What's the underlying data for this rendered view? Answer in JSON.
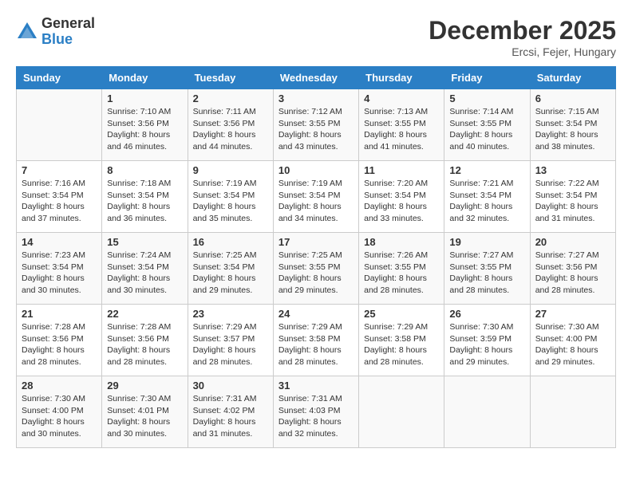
{
  "logo": {
    "general": "General",
    "blue": "Blue"
  },
  "title": {
    "month": "December 2025",
    "location": "Ercsi, Fejer, Hungary"
  },
  "weekdays": [
    "Sunday",
    "Monday",
    "Tuesday",
    "Wednesday",
    "Thursday",
    "Friday",
    "Saturday"
  ],
  "weeks": [
    [
      {
        "day": "",
        "info": ""
      },
      {
        "day": "1",
        "info": "Sunrise: 7:10 AM\nSunset: 3:56 PM\nDaylight: 8 hours\nand 46 minutes."
      },
      {
        "day": "2",
        "info": "Sunrise: 7:11 AM\nSunset: 3:56 PM\nDaylight: 8 hours\nand 44 minutes."
      },
      {
        "day": "3",
        "info": "Sunrise: 7:12 AM\nSunset: 3:55 PM\nDaylight: 8 hours\nand 43 minutes."
      },
      {
        "day": "4",
        "info": "Sunrise: 7:13 AM\nSunset: 3:55 PM\nDaylight: 8 hours\nand 41 minutes."
      },
      {
        "day": "5",
        "info": "Sunrise: 7:14 AM\nSunset: 3:55 PM\nDaylight: 8 hours\nand 40 minutes."
      },
      {
        "day": "6",
        "info": "Sunrise: 7:15 AM\nSunset: 3:54 PM\nDaylight: 8 hours\nand 38 minutes."
      }
    ],
    [
      {
        "day": "7",
        "info": "Sunrise: 7:16 AM\nSunset: 3:54 PM\nDaylight: 8 hours\nand 37 minutes."
      },
      {
        "day": "8",
        "info": "Sunrise: 7:18 AM\nSunset: 3:54 PM\nDaylight: 8 hours\nand 36 minutes."
      },
      {
        "day": "9",
        "info": "Sunrise: 7:19 AM\nSunset: 3:54 PM\nDaylight: 8 hours\nand 35 minutes."
      },
      {
        "day": "10",
        "info": "Sunrise: 7:19 AM\nSunset: 3:54 PM\nDaylight: 8 hours\nand 34 minutes."
      },
      {
        "day": "11",
        "info": "Sunrise: 7:20 AM\nSunset: 3:54 PM\nDaylight: 8 hours\nand 33 minutes."
      },
      {
        "day": "12",
        "info": "Sunrise: 7:21 AM\nSunset: 3:54 PM\nDaylight: 8 hours\nand 32 minutes."
      },
      {
        "day": "13",
        "info": "Sunrise: 7:22 AM\nSunset: 3:54 PM\nDaylight: 8 hours\nand 31 minutes."
      }
    ],
    [
      {
        "day": "14",
        "info": "Sunrise: 7:23 AM\nSunset: 3:54 PM\nDaylight: 8 hours\nand 30 minutes."
      },
      {
        "day": "15",
        "info": "Sunrise: 7:24 AM\nSunset: 3:54 PM\nDaylight: 8 hours\nand 30 minutes."
      },
      {
        "day": "16",
        "info": "Sunrise: 7:25 AM\nSunset: 3:54 PM\nDaylight: 8 hours\nand 29 minutes."
      },
      {
        "day": "17",
        "info": "Sunrise: 7:25 AM\nSunset: 3:55 PM\nDaylight: 8 hours\nand 29 minutes."
      },
      {
        "day": "18",
        "info": "Sunrise: 7:26 AM\nSunset: 3:55 PM\nDaylight: 8 hours\nand 28 minutes."
      },
      {
        "day": "19",
        "info": "Sunrise: 7:27 AM\nSunset: 3:55 PM\nDaylight: 8 hours\nand 28 minutes."
      },
      {
        "day": "20",
        "info": "Sunrise: 7:27 AM\nSunset: 3:56 PM\nDaylight: 8 hours\nand 28 minutes."
      }
    ],
    [
      {
        "day": "21",
        "info": "Sunrise: 7:28 AM\nSunset: 3:56 PM\nDaylight: 8 hours\nand 28 minutes."
      },
      {
        "day": "22",
        "info": "Sunrise: 7:28 AM\nSunset: 3:56 PM\nDaylight: 8 hours\nand 28 minutes."
      },
      {
        "day": "23",
        "info": "Sunrise: 7:29 AM\nSunset: 3:57 PM\nDaylight: 8 hours\nand 28 minutes."
      },
      {
        "day": "24",
        "info": "Sunrise: 7:29 AM\nSunset: 3:58 PM\nDaylight: 8 hours\nand 28 minutes."
      },
      {
        "day": "25",
        "info": "Sunrise: 7:29 AM\nSunset: 3:58 PM\nDaylight: 8 hours\nand 28 minutes."
      },
      {
        "day": "26",
        "info": "Sunrise: 7:30 AM\nSunset: 3:59 PM\nDaylight: 8 hours\nand 29 minutes."
      },
      {
        "day": "27",
        "info": "Sunrise: 7:30 AM\nSunset: 4:00 PM\nDaylight: 8 hours\nand 29 minutes."
      }
    ],
    [
      {
        "day": "28",
        "info": "Sunrise: 7:30 AM\nSunset: 4:00 PM\nDaylight: 8 hours\nand 30 minutes."
      },
      {
        "day": "29",
        "info": "Sunrise: 7:30 AM\nSunset: 4:01 PM\nDaylight: 8 hours\nand 30 minutes."
      },
      {
        "day": "30",
        "info": "Sunrise: 7:31 AM\nSunset: 4:02 PM\nDaylight: 8 hours\nand 31 minutes."
      },
      {
        "day": "31",
        "info": "Sunrise: 7:31 AM\nSunset: 4:03 PM\nDaylight: 8 hours\nand 32 minutes."
      },
      {
        "day": "",
        "info": ""
      },
      {
        "day": "",
        "info": ""
      },
      {
        "day": "",
        "info": ""
      }
    ]
  ]
}
